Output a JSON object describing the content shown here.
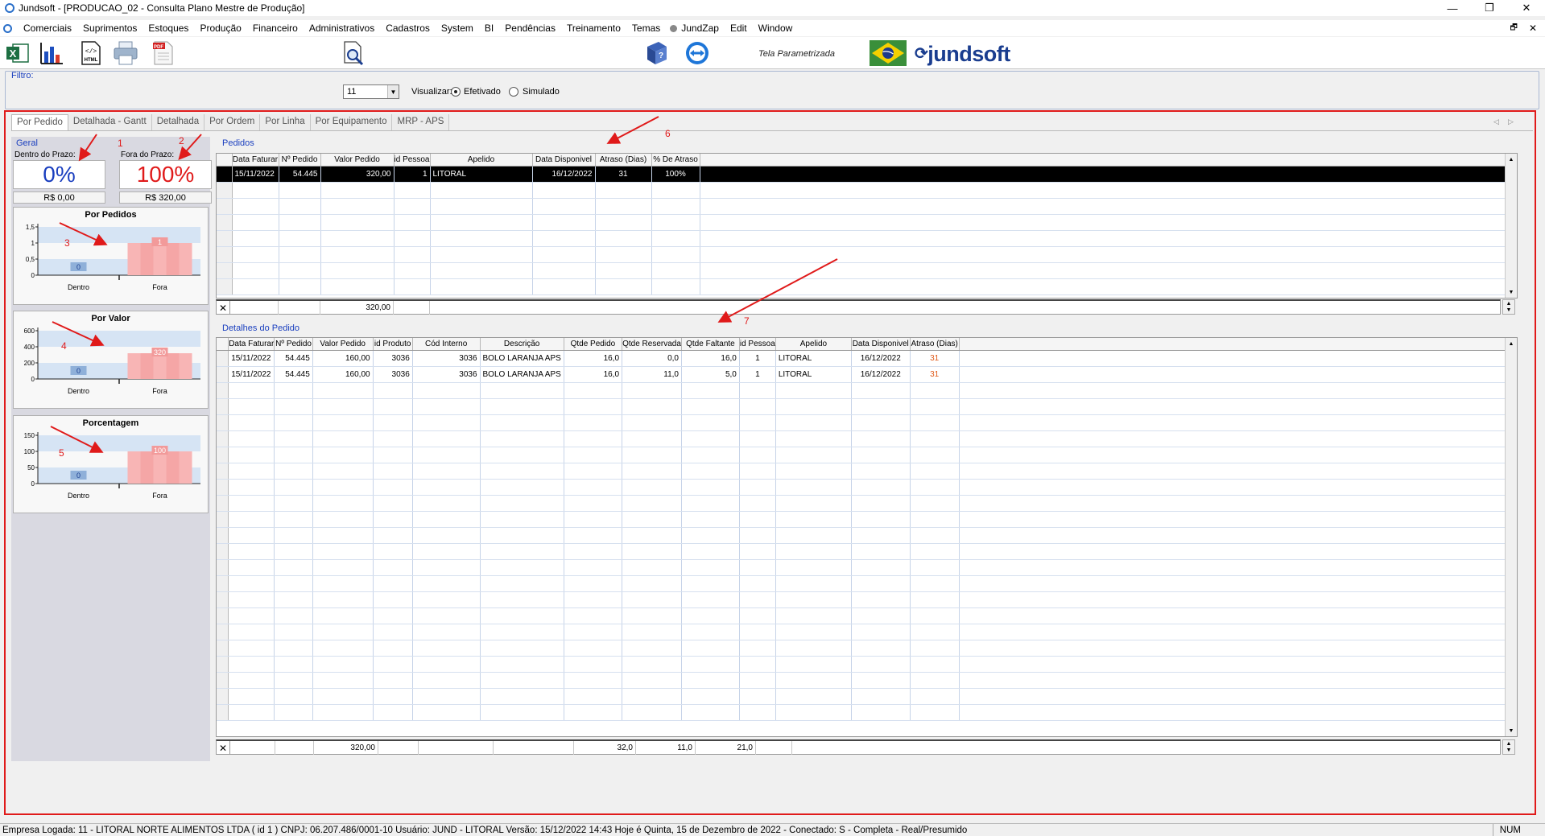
{
  "window": {
    "title": "Jundsoft - [PRODUCAO_02 - Consulta Plano Mestre de Produção]",
    "minimize": "—",
    "restore": "❐",
    "close": "✕",
    "mdi_restore": "🗗",
    "mdi_close": "✕"
  },
  "menu": [
    "Comerciais",
    "Suprimentos",
    "Estoques",
    "Produção",
    "Financeiro",
    "Administrativos",
    "Cadastros",
    "System",
    "BI",
    "Pendências",
    "Treinamento",
    "Temas",
    "JundZap",
    "Edit",
    "Window"
  ],
  "toolbar": {
    "parametrizada": "Tela Parametrizada",
    "logo": "jundsoft",
    "excel_icon": "excel-icon",
    "chart_icon": "chart-icon",
    "html_icon": "html-export-icon",
    "print_icon": "printer-icon",
    "pdf_icon": "pdf-icon",
    "search_icon": "search-document-icon",
    "help_icon": "help-book-icon",
    "teamviewer_icon": "remote-support-icon",
    "flag_icon": "brazil-flag-icon"
  },
  "filter": {
    "label": "Filtro:",
    "select_value": "11",
    "view_label": "Visualizar:",
    "option_efetivado": "Efetivado",
    "option_simulado": "Simulado",
    "selected": "Efetivado"
  },
  "tabs": [
    "Por Pedido",
    "Detalhada - Gantt",
    "Detalhada",
    "Por Ordem",
    "Por Linha",
    "Por Equipamento",
    "MRP - APS"
  ],
  "active_tab": "Por Pedido",
  "geral": {
    "label": "Geral",
    "dentro_label": "Dentro do Prazo:",
    "fora_label": "Fora do Prazo:",
    "dentro_pct": "0%",
    "fora_pct": "100%",
    "dentro_valor": "R$ 0,00",
    "fora_valor": "R$ 320,00"
  },
  "annotations": [
    "1",
    "2",
    "3",
    "4",
    "5",
    "6",
    "7"
  ],
  "chart_data": [
    {
      "type": "bar",
      "title": "Por Pedidos",
      "categories": [
        "Dentro",
        "Fora"
      ],
      "values": [
        0,
        1
      ],
      "yticks": [
        "0",
        "0,5",
        "1",
        "1,5"
      ],
      "ylim": [
        0,
        1.5
      ]
    },
    {
      "type": "bar",
      "title": "Por Valor",
      "categories": [
        "Dentro",
        "Fora"
      ],
      "values": [
        0,
        320
      ],
      "yticks": [
        "0",
        "200",
        "400",
        "600"
      ],
      "ylim": [
        0,
        600
      ]
    },
    {
      "type": "bar",
      "title": "Porcentagem",
      "categories": [
        "Dentro",
        "Fora"
      ],
      "values": [
        0,
        100
      ],
      "yticks": [
        "0",
        "50",
        "100",
        "150"
      ],
      "ylim": [
        0,
        150
      ]
    }
  ],
  "pedidos": {
    "label": "Pedidos",
    "columns": [
      "Data Faturar",
      "Nº Pedido",
      "Valor Pedido",
      "id Pessoa",
      "Apelido",
      "Data Disponivel",
      "Atraso (Dias)",
      "% De Atraso"
    ],
    "rows": [
      [
        "15/11/2022",
        "54.445",
        "320,00",
        "1",
        "LITORAL",
        "16/12/2022",
        "31",
        "100%"
      ]
    ],
    "footer_total": "320,00"
  },
  "detalhes": {
    "label": "Detalhes do Pedido",
    "columns": [
      "Data Faturar",
      "Nº Pedido",
      "Valor Pedido",
      "id Produto",
      "Cód Interno",
      "Descrição",
      "Qtde Pedido",
      "Qtde Reservada",
      "Qtde Faltante",
      "id Pessoa",
      "Apelido",
      "Data Disponivel",
      "Atraso (Dias)"
    ],
    "rows": [
      [
        "15/11/2022",
        "54.445",
        "160,00",
        "3036",
        "3036",
        "BOLO LARANJA APS",
        "16,0",
        "0,0",
        "16,0",
        "1",
        "LITORAL",
        "16/12/2022",
        "31"
      ],
      [
        "15/11/2022",
        "54.445",
        "160,00",
        "3036",
        "3036",
        "BOLO LARANJA APS",
        "16,0",
        "11,0",
        "5,0",
        "1",
        "LITORAL",
        "16/12/2022",
        "31"
      ]
    ],
    "footer": {
      "valor": "320,00",
      "qtde_pedido": "32,0",
      "qtde_reservada": "11,0",
      "qtde_faltante": "21,0"
    }
  },
  "status": {
    "text": "Empresa Logada: 11 - LITORAL NORTE ALIMENTOS LTDA ( id 1 ) CNPJ: 06.207.486/0001-10   Usuário: JUND - LITORAL   Versão: 15/12/2022 14:43   Hoje é Quinta, 15 de Dezembro de 2022 - Conectado: S - Completa - Real/Presumido",
    "num": "NUM"
  },
  "colors": {
    "accent_blue": "#1a3fbf",
    "annotation_red": "#e01a1a",
    "bar_fora": "#f7a3a3",
    "bar_dentro_band": "#cfe0f3"
  }
}
